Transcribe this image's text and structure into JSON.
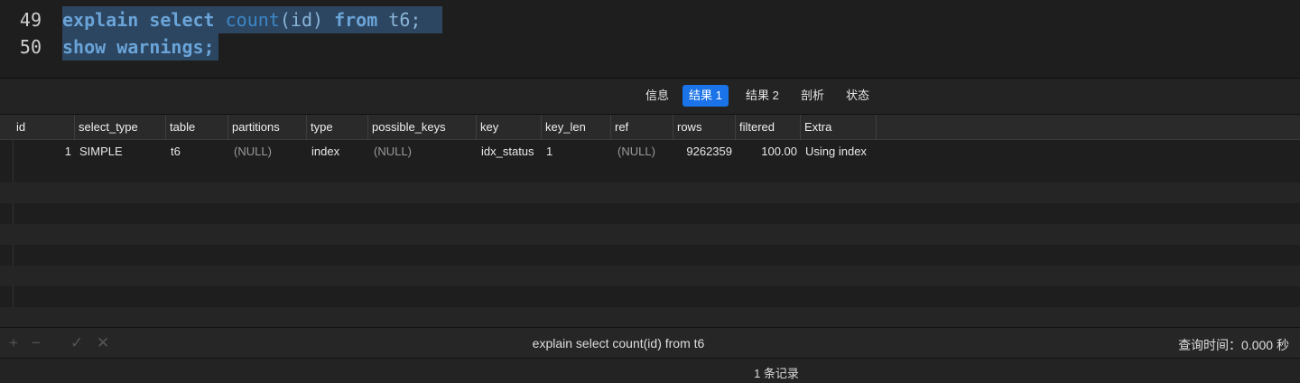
{
  "editor": {
    "lines": [
      {
        "number": "49",
        "tokens": [
          "explain",
          "select",
          "count",
          "(id)",
          "from",
          "t6;"
        ]
      },
      {
        "number": "50",
        "tokens": [
          "show",
          "warnings;"
        ]
      }
    ]
  },
  "tabs": [
    {
      "label": "信息",
      "active": false
    },
    {
      "label": "结果 1",
      "active": true
    },
    {
      "label": "结果 2",
      "active": false
    },
    {
      "label": "剖析",
      "active": false
    },
    {
      "label": "状态",
      "active": false
    }
  ],
  "grid": {
    "columns": [
      "id",
      "select_type",
      "table",
      "partitions",
      "type",
      "possible_keys",
      "key",
      "key_len",
      "ref",
      "rows",
      "filtered",
      "Extra"
    ],
    "rows": [
      {
        "id": "1",
        "select_type": "SIMPLE",
        "table": "t6",
        "partitions": "(NULL)",
        "type": "index",
        "possible_keys": "(NULL)",
        "key": "idx_status",
        "key_len": "1",
        "ref": "(NULL)",
        "rows": "9262359",
        "filtered": "100.00",
        "Extra": "Using index"
      }
    ]
  },
  "toolbar": {
    "icons": [
      "plus-icon",
      "minus-icon",
      "check-icon",
      "close-icon"
    ],
    "sql_status": "explain select count(id) from t6",
    "query_time": "查询时间：0.000 秒"
  },
  "recordbar": {
    "record_count": "1 条记录"
  },
  "colors": {
    "selection": "#2c4661",
    "active_tab": "#1a73e8",
    "keyword": "#6aa4d8",
    "function": "#3d86c6"
  }
}
